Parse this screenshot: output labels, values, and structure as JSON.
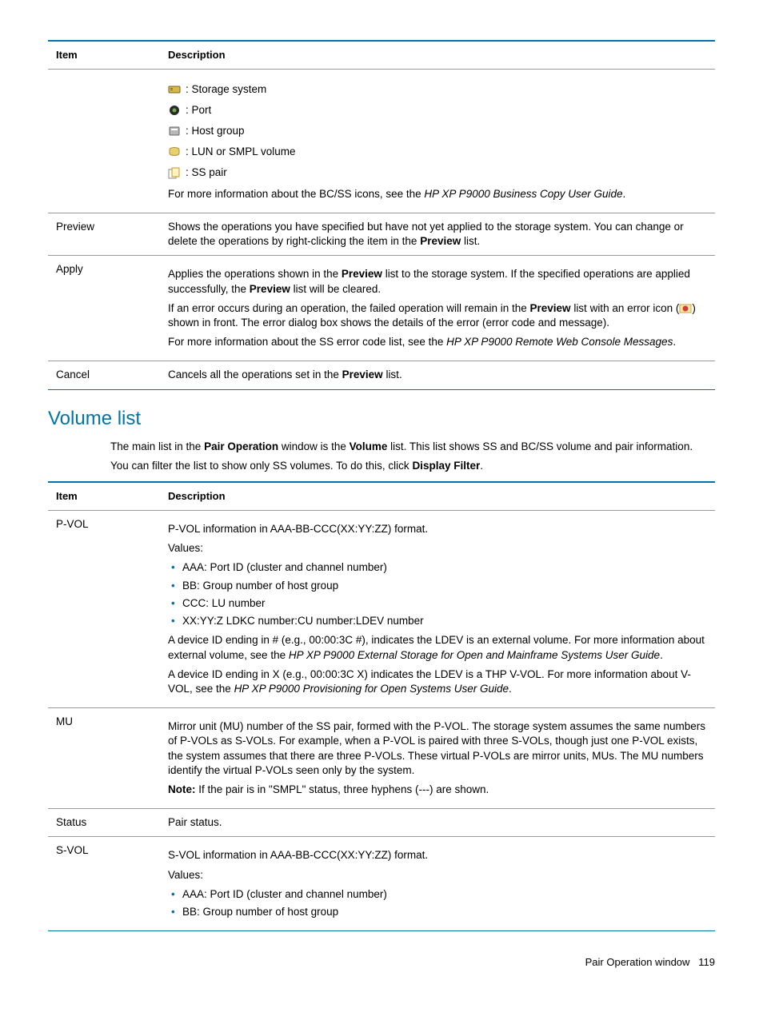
{
  "table1": {
    "headers": {
      "item": "Item",
      "desc": "Description"
    },
    "rows": {
      "icons": {
        "item": "",
        "storage": ": Storage system",
        "port": ": Port",
        "hostgroup": ": Host group",
        "lun": ": LUN or SMPL volume",
        "sspair": ": SS pair",
        "more_pre": "For more information about the BC/SS icons, see the ",
        "more_italic": "HP XP P9000 Business Copy User Guide",
        "more_post": "."
      },
      "preview": {
        "item": "Preview",
        "d1a": "Shows the operations you have specified but have not yet applied to the storage system. You can change or delete the operations by right-clicking the item in the ",
        "d1b": "Preview",
        "d1c": " list."
      },
      "apply": {
        "item": "Apply",
        "p1a": "Applies the operations shown in the ",
        "p1b": "Preview",
        "p1c": " list to the storage system. If the specified operations are applied successfully, the ",
        "p1d": "Preview",
        "p1e": " list will be cleared.",
        "p2a": "If an error occurs during an operation, the failed operation will remain in the ",
        "p2b": "Preview",
        "p2c": " list with an error icon (",
        "p2d": ") shown in front. The error dialog box shows the details of the error (error code and message).",
        "p3a": "For more information about the SS error code list, see the ",
        "p3b": "HP XP P9000 Remote Web Console Messages",
        "p3c": "."
      },
      "cancel": {
        "item": "Cancel",
        "d1a": "Cancels all the operations set in the ",
        "d1b": "Preview",
        "d1c": " list."
      }
    }
  },
  "section": {
    "title": "Volume list",
    "intro1a": "The main list in the ",
    "intro1b": "Pair Operation",
    "intro1c": " window is the ",
    "intro1d": "Volume",
    "intro1e": " list. This list shows SS and BC/SS volume and pair information.",
    "intro2a": "You can filter the list to show only SS volumes. To do this, click ",
    "intro2b": "Display Filter",
    "intro2c": "."
  },
  "table2": {
    "headers": {
      "item": "Item",
      "desc": "Description"
    },
    "rows": {
      "pvol": {
        "item": "P-VOL",
        "p1": "P-VOL information in AAA-BB-CCC(XX:YY:ZZ) format.",
        "p2": "Values:",
        "b1": "AAA: Port ID (cluster and channel number)",
        "b2": "BB: Group number of host group",
        "b3": "CCC: LU number",
        "b4": "XX:YY:Z LDKC number:CU number:LDEV number",
        "p3a": "A device ID ending in # (e.g., 00:00:3C #), indicates the LDEV is an external volume. For more information about external volume, see the ",
        "p3b": "HP XP P9000 External Storage for Open and Mainframe Systems User Guide",
        "p3c": ".",
        "p4a": "A device ID ending in X (e.g., 00:00:3C X) indicates the LDEV is a THP V-VOL. For more information about V-VOL, see the ",
        "p4b": "HP XP P9000 Provisioning for Open Systems User Guide",
        "p4c": "."
      },
      "mu": {
        "item": "MU",
        "p1": "Mirror unit (MU) number of the SS pair, formed with the P-VOL. The storage system assumes the same numbers of P-VOLs as S-VOLs. For example, when a P-VOL is paired with three S-VOLs, though just one P-VOL exists, the system assumes that there are three P-VOLs. These virtual P-VOLs are mirror units, MUs. The MU numbers identify the virtual P-VOLs seen only by the system.",
        "p2a": "Note:",
        "p2b": " If the pair is in \"SMPL\" status, three hyphens (---) are shown."
      },
      "status": {
        "item": "Status",
        "d": "Pair status."
      },
      "svol": {
        "item": "S-VOL",
        "p1": "S-VOL information in AAA-BB-CCC(XX:YY:ZZ) format.",
        "p2": "Values:",
        "b1": "AAA: Port ID (cluster and channel number)",
        "b2": "BB: Group number of host group"
      }
    }
  },
  "footer": {
    "label": "Pair Operation window",
    "page": "119"
  }
}
